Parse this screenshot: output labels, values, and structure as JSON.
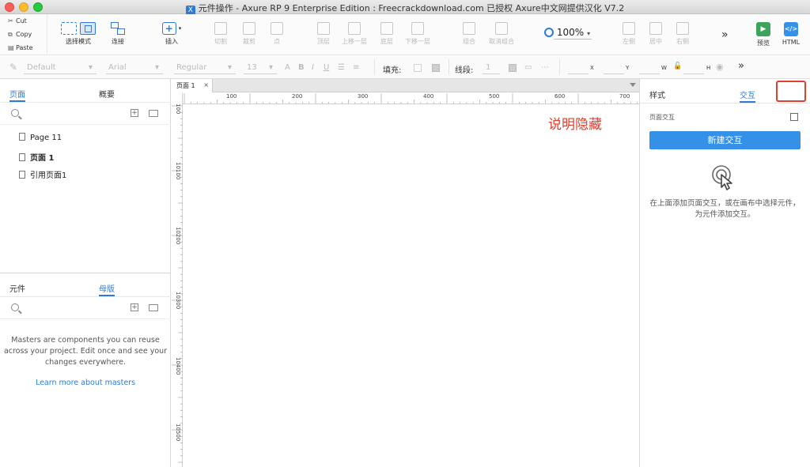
{
  "window": {
    "title": "元件操作 - Axure RP 9 Enterprise Edition : Freecrackdownload.com 已授权      Axure中文网提供汉化 V7.2"
  },
  "clipboard": {
    "cut": "Cut",
    "copy": "Copy",
    "paste": "Paste"
  },
  "toolbar": {
    "select_mode": "选择模式",
    "connect": "连接",
    "insert": "插入",
    "cut": "切割",
    "crop": "裁剪",
    "point": "点",
    "top": "顶层",
    "up_one": "上移一层",
    "bottom": "底层",
    "down_one": "下移一层",
    "group": "组合",
    "ungroup": "取消组合",
    "zoom": "100%",
    "align_left": "左侧",
    "align_center": "居中",
    "align_right": "右侧",
    "preview": "预览",
    "html": "HTML"
  },
  "stylebar": {
    "style": "Default",
    "font": "Arial",
    "weight": "Regular",
    "size": "13",
    "fill_label": "填充:",
    "stroke_label": "线段:",
    "stroke_value": "1",
    "x": "X",
    "y": "Y",
    "w": "W",
    "h": "H"
  },
  "left_panel": {
    "tab_pages": "页面",
    "tab_outline": "概要",
    "pages": [
      "Page 11",
      "页面 1",
      "引用页面1"
    ],
    "tab_widgets": "元件",
    "tab_masters": "母版",
    "masters_message": "Masters are components you can reuse across your project. Edit once and see your changes everywhere.",
    "masters_link": "Learn more about masters"
  },
  "canvas": {
    "doc_tab": "页面 1",
    "ruler_top": [
      "100",
      "200",
      "300",
      "400",
      "500",
      "600",
      "700"
    ],
    "ruler_left": [
      "100",
      "10100",
      "10200",
      "10300",
      "10400",
      "10500"
    ],
    "annotation": "说明隐藏"
  },
  "right_panel": {
    "tab_style": "样式",
    "tab_interactions": "交互",
    "page_interactions": "页面交互",
    "new_interaction": "新建交互",
    "hint": "在上面添加页面交互，或在画布中选择元件，为元件添加交互。"
  },
  "colors": {
    "accent": "#2e7bd6",
    "annotation": "#e0402f",
    "button": "#3590e8"
  }
}
